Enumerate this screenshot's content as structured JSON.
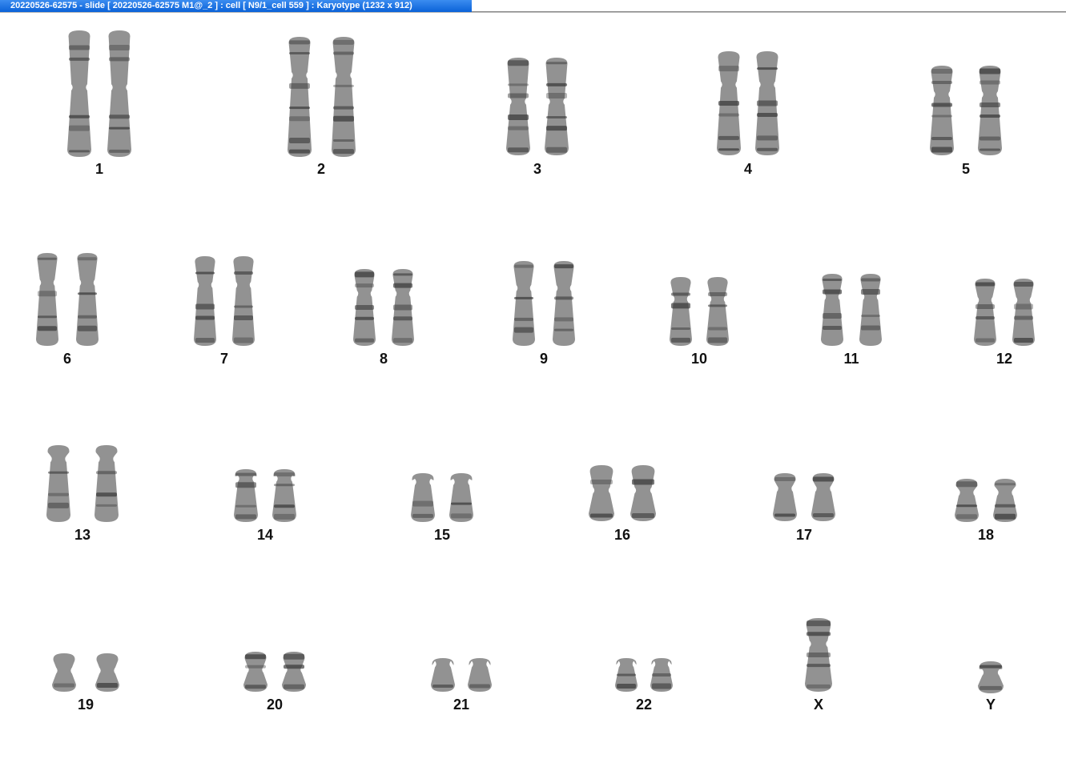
{
  "window": {
    "title": "20220526-62575 - slide [ 20220526-62575 M1@_2 ] : cell [ N9/1_cell 559 ] : Karyotype  (1232 x 912)"
  },
  "colors": {
    "titlebar": "#0a62d8",
    "chromosome": "#6e6e6e",
    "band_dark": "#2f2f2f",
    "label": "#111111"
  },
  "karyotype": {
    "chromosomes": [
      {
        "label": "1"
      },
      {
        "label": "2"
      },
      {
        "label": "3"
      },
      {
        "label": "4"
      },
      {
        "label": "5"
      },
      {
        "label": "6"
      },
      {
        "label": "7"
      },
      {
        "label": "8"
      },
      {
        "label": "9"
      },
      {
        "label": "10"
      },
      {
        "label": "11"
      },
      {
        "label": "12"
      },
      {
        "label": "13"
      },
      {
        "label": "14"
      },
      {
        "label": "15"
      },
      {
        "label": "16"
      },
      {
        "label": "17"
      },
      {
        "label": "18"
      },
      {
        "label": "19"
      },
      {
        "label": "20"
      },
      {
        "label": "21"
      },
      {
        "label": "22"
      },
      {
        "label": "X"
      },
      {
        "label": "Y"
      }
    ]
  }
}
